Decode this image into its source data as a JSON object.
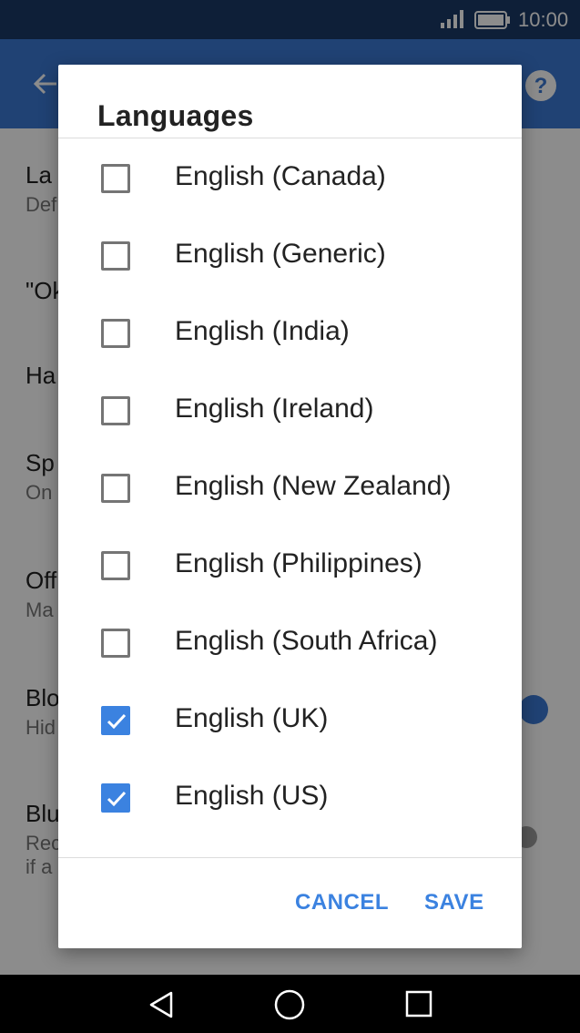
{
  "status_bar": {
    "time": "10:00",
    "signal_icon": "signal-icon",
    "battery_icon": "battery-icon"
  },
  "app_bar": {
    "back_icon": "arrow-back-icon",
    "help_icon": "help-icon"
  },
  "background_settings": [
    {
      "title": "La",
      "subtitle": "Def"
    },
    {
      "title": "\"Ok",
      "subtitle": ""
    },
    {
      "title": "Ha",
      "subtitle": ""
    },
    {
      "title": "Sp",
      "subtitle": "On"
    },
    {
      "title": "Off",
      "subtitle": "Ma"
    },
    {
      "title": "Blo",
      "subtitle": "Hid"
    },
    {
      "title": "Blu",
      "subtitle": "Rec",
      "subtitle2": "if a"
    }
  ],
  "dialog": {
    "title": "Languages",
    "items": [
      {
        "label": "English (Canada)",
        "checked": false
      },
      {
        "label": "English (Generic)",
        "checked": false
      },
      {
        "label": "English (India)",
        "checked": false
      },
      {
        "label": "English (Ireland)",
        "checked": false
      },
      {
        "label": "English (New Zealand)",
        "checked": false
      },
      {
        "label": "English (Philippines)",
        "checked": false
      },
      {
        "label": "English (South Africa)",
        "checked": false
      },
      {
        "label": "English (UK)",
        "checked": true
      },
      {
        "label": "English (US)",
        "checked": true
      }
    ],
    "cancel_label": "CANCEL",
    "save_label": "SAVE"
  },
  "colors": {
    "accent": "#3b82e0",
    "app_bar": "#3b79d4",
    "status_bar": "#1a3a66"
  }
}
